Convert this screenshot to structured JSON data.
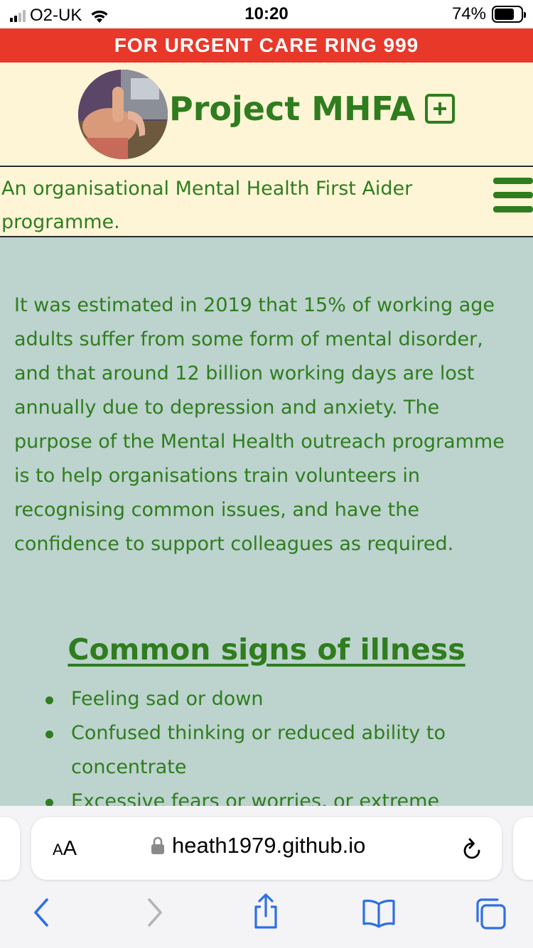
{
  "status_bar": {
    "carrier": "O2-UK",
    "time": "10:20",
    "battery_percent": "74%",
    "battery_level": 0.74
  },
  "banner": {
    "text": "FOR URGENT CARE RING 999",
    "color": "#e8382a"
  },
  "header": {
    "title": "Project MHFA",
    "tagline": "An organisational Mental Health First Aider programme."
  },
  "main": {
    "intro": "It was estimated in 2019 that 15% of working age adults suffer from some form of mental disorder, and that around 12 billion working days are lost annually due to depression and anxiety. The purpose of the Mental Health outreach programme is to help organisations train volunteers in recognising common issues, and have the confidence to support colleagues as required.",
    "section_title": "Common signs of illness",
    "signs": [
      "Feeling sad or down",
      "Confused thinking or reduced ability to concentrate",
      "Excessive fears or worries, or extreme"
    ]
  },
  "browser": {
    "text_size_label_small": "A",
    "text_size_label_big": "A",
    "url": "heath1979.github.io"
  },
  "colors": {
    "brand_green": "#2f7d1e",
    "header_background": "#fdf5d6",
    "content_background": "#bcd3ce",
    "browser_accent": "#2f6fe4"
  },
  "icons": [
    "signal-icon",
    "wifi-icon",
    "battery-icon",
    "plus-box-icon",
    "hamburger-menu-icon",
    "lock-icon",
    "reload-icon",
    "back-icon",
    "forward-icon",
    "share-icon",
    "bookmarks-icon",
    "tabs-icon"
  ]
}
